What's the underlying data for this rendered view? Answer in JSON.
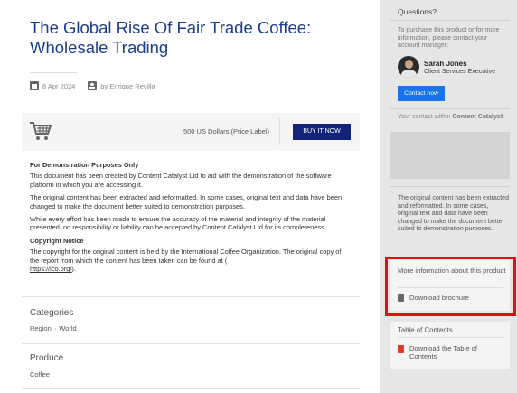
{
  "article": {
    "title": "The Global Rise Of Fair Trade Coffee: Wholesale Trading",
    "date": "8 Apr 2024",
    "author": "by Enrique Revilla"
  },
  "purchase": {
    "price": "500 US Dollars (Price Label)",
    "buy_label": "BUY IT NOW",
    "cart_icon": "shopping-cart-icon"
  },
  "description": {
    "demo_heading": "For Demonstration Purposes Only",
    "p1": "This document has been created by Content Catalyst Ltd to aid with the demonstration of the software platform in which you are accessing it.",
    "p2": "The original content has been extracted and reformatted. In some cases, original text and data have been changed to make the document better suited to demonstration purposes.",
    "p3": "While every effort has been made to ensure the accuracy of the material and integrity of the material presented, no responsibility or liability can be accepted by Content Catalyst Ltd for its completeness.",
    "copyright_heading": "Copyright Notice",
    "p4": "The copyright for the original content is held by the International Coffee Organization. The original copy of the report from which the content has been taken can be found at (",
    "link": "https://ico.org/",
    "p4_end": ")."
  },
  "categories": {
    "title": "Categories",
    "items": [
      "Region",
      "World"
    ],
    "separator": "›"
  },
  "produce": {
    "title": "Produce",
    "value": "Coffee"
  },
  "sidebar": {
    "questions_title": "Questions?",
    "questions_text": "To purchase this product or for more information, please contact your account manager:",
    "manager_name": "Sarah Jones",
    "manager_role": "Client Services Executive",
    "contact_label": "Contact now",
    "within_prefix": "Your contact within ",
    "within_company": "Content Catalyst",
    "within_suffix": ":",
    "note": "The original content has been extracted and reformatted. In some cases, original text and data have been changed to make the document better suited to demonstration purposes.",
    "more_info_title": "More information about this product",
    "download_brochure": "Download brochure",
    "toc_title": "Table of Contents",
    "download_toc": "Download the Table of Contents"
  },
  "colors": {
    "title": "#1a3c8c",
    "buy_button": "#14237a",
    "contact_button": "#1a73e8",
    "highlight": "#e01010"
  }
}
